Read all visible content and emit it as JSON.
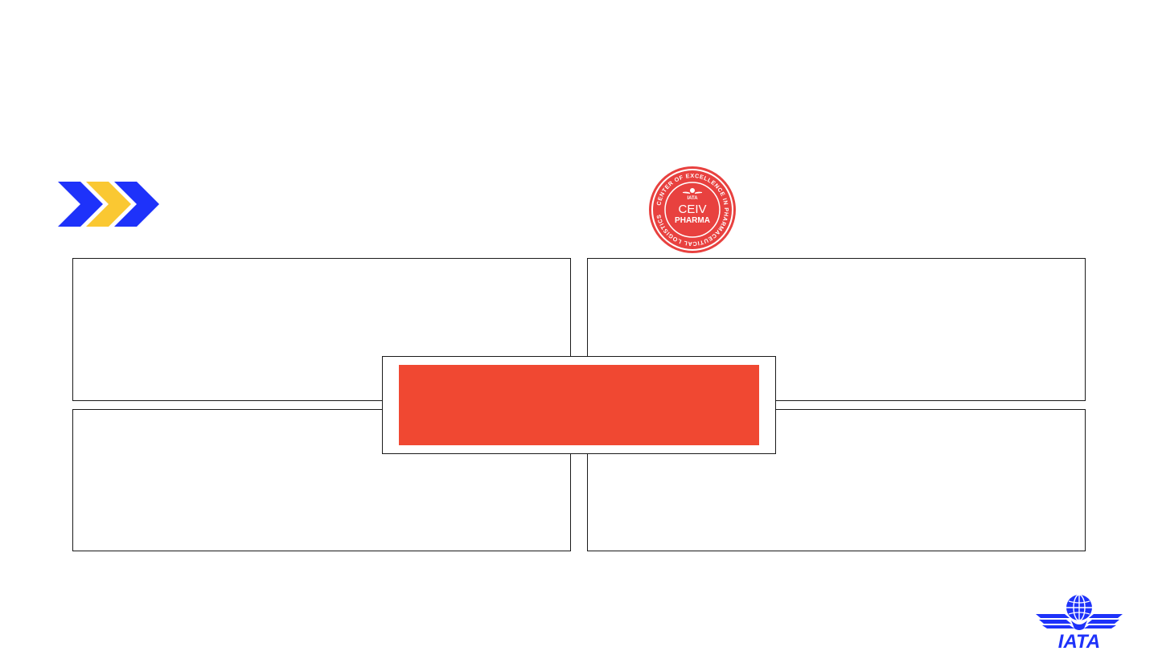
{
  "slide": {
    "seal": {
      "brand": "IATA",
      "title": "CEIV",
      "subtitle": "PHARMA",
      "ring_text": "CENTER OF EXCELLENCE IN PHARMACEUTICAL LOGISTICS",
      "color": "#e8413f"
    },
    "logo": {
      "text": "IATA",
      "color": "#1e32fa"
    },
    "center_banner": {
      "color": "#f04832"
    },
    "chevrons": {
      "colors": [
        "#1e32fa",
        "#fac832",
        "#1e32fa"
      ],
      "icon": "triple-chevron-right-icon"
    }
  }
}
